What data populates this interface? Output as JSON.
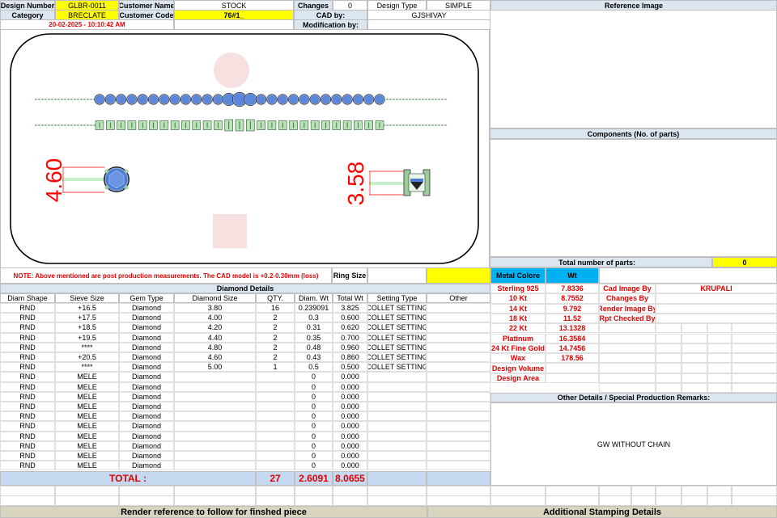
{
  "header": {
    "design_number_label": "Design Number",
    "design_number": "GLBR-0011",
    "customer_name_label": "Customer Name",
    "customer_name": "STOCK",
    "changes_label": "Changes",
    "changes": "0",
    "design_type_label": "Design Type",
    "design_type": "SIMPLE",
    "category_label": "Category",
    "category": "BRECLATE",
    "customer_code_label": "Customer Code",
    "customer_code": "76#1_",
    "cad_by_label": "CAD by:",
    "cad_by": "GJSHIVAY",
    "timestamp": "20-02-2025 - 10:10:42 AM",
    "modification_by_label": "Modification by:",
    "modification_by": ""
  },
  "drawing": {
    "dim_left": "4.60",
    "dim_right": "3.58"
  },
  "right_panel": {
    "reference_image_title": "Reference Image",
    "components_title": "Components (No. of parts)",
    "total_parts_label": "Total number of parts:",
    "total_parts": "0"
  },
  "note": {
    "text": "NOTE: Above mentioned are post production measurements. The CAD model is +0.2-0.30mm (loss)",
    "ring_size_label": "Ring Size",
    "ring_size": ""
  },
  "diamond_details": {
    "title": "Diamond Details",
    "columns": [
      "Diam Shape",
      "Sieve Size",
      "Gem Type",
      "Diamond Size",
      "QTY.",
      "Diam. Wt",
      "Total Wt",
      "Setting Type",
      "Other"
    ],
    "rows": [
      [
        "RND",
        "+16.5",
        "Diamond",
        "3.80",
        "16",
        "0.239091",
        "3.825",
        "COLLET SETTING",
        ""
      ],
      [
        "RND",
        "+17.5",
        "Diamond",
        "4.00",
        "2",
        "0.3",
        "0.600",
        "COLLET SETTING",
        ""
      ],
      [
        "RND",
        "+18.5",
        "Diamond",
        "4.20",
        "2",
        "0.31",
        "0.620",
        "COLLET SETTING",
        ""
      ],
      [
        "RND",
        "+19.5",
        "Diamond",
        "4.40",
        "2",
        "0.35",
        "0.700",
        "COLLET SETTING",
        ""
      ],
      [
        "RND",
        "****",
        "Diamond",
        "4.80",
        "2",
        "0.48",
        "0.960",
        "COLLET SETTING",
        ""
      ],
      [
        "RND",
        "+20.5",
        "Diamond",
        "4.60",
        "2",
        "0.43",
        "0.860",
        "COLLET SETTING",
        ""
      ],
      [
        "RND",
        "****",
        "Diamond",
        "5.00",
        "1",
        "0.5",
        "0.500",
        "COLLET SETTING",
        ""
      ],
      [
        "RND",
        "MELE",
        "Diamond",
        "",
        "",
        "0",
        "0.000",
        "",
        ""
      ],
      [
        "RND",
        "MELE",
        "Diamond",
        "",
        "",
        "0",
        "0.000",
        "",
        ""
      ],
      [
        "RND",
        "MELE",
        "Diamond",
        "",
        "",
        "0",
        "0.000",
        "",
        ""
      ],
      [
        "RND",
        "MELE",
        "Diamond",
        "",
        "",
        "0",
        "0.000",
        "",
        ""
      ],
      [
        "RND",
        "MELE",
        "Diamond",
        "",
        "",
        "0",
        "0.000",
        "",
        ""
      ],
      [
        "RND",
        "MELE",
        "Diamond",
        "",
        "",
        "0",
        "0.000",
        "",
        ""
      ],
      [
        "RND",
        "MELE",
        "Diamond",
        "",
        "",
        "0",
        "0.000",
        "",
        ""
      ],
      [
        "RND",
        "MELE",
        "Diamond",
        "",
        "",
        "0",
        "0.000",
        "",
        ""
      ],
      [
        "RND",
        "MELE",
        "Diamond",
        "",
        "",
        "0",
        "0.000",
        "",
        ""
      ],
      [
        "RND",
        "MELE",
        "Diamond",
        "",
        "",
        "0",
        "0.000",
        "",
        ""
      ]
    ],
    "total_label": "TOTAL :",
    "total_qty": "27",
    "total_diam_wt": "2.6091",
    "total_wt": "8.0655"
  },
  "metal": {
    "metal_color_label": "Metal Colore",
    "wt_label": "Wt",
    "rows": [
      [
        "Sterling 925",
        "7.8336"
      ],
      [
        "10 Kt",
        "8.7552"
      ],
      [
        "14 Kt",
        "9.792"
      ],
      [
        "18 Kt",
        "11.52"
      ],
      [
        "22 Kt",
        "13.1328"
      ],
      [
        "Platinum",
        "16.3584"
      ],
      [
        "24 Kt Fine Gold",
        "14.7456"
      ],
      [
        "Wax",
        "178.56"
      ],
      [
        "Design Volume",
        ""
      ],
      [
        "Design Area",
        ""
      ]
    ]
  },
  "credits": {
    "cad_image_by_label": "Cad Image By",
    "cad_image_by": "KRUPALI",
    "changes_by_label": "Changes By",
    "render_image_by_label": "Render Image By",
    "rpt_checked_by_label": "Rpt Checked By"
  },
  "other_details": {
    "title": "Other Details / Special Production Remarks:",
    "remark": "GW WITHOUT CHAIN"
  },
  "footer": {
    "left": "Render reference to follow for finshed piece",
    "right": "Additional Stamping Details"
  },
  "colors": {
    "label_bg": "#dce6f1",
    "highlight": "#ffff00",
    "accent_blue": "#00b0f0",
    "red_text": "#e00000",
    "total_bg": "#c5d9f1",
    "footer_bg": "#d8d4c0"
  }
}
